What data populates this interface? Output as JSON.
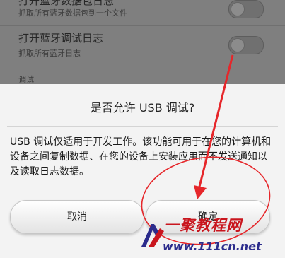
{
  "settings": {
    "row1": {
      "title": "打开蓝牙数据包日志",
      "subtitle": "抓取所有蓝牙数据包到一个文件"
    },
    "row2": {
      "title": "打开蓝牙调试日志",
      "subtitle": "抓取所有蓝牙日志"
    },
    "section_label": "调试"
  },
  "dialog": {
    "title": "是否允许 USB 调试?",
    "message": "USB 调试仅适用于开发工作。该功能可用于在您的计算机和设备之间复制数据、在您的设备上安装应用而不发送通知以及读取日志数据。",
    "cancel_label": "取消",
    "ok_label": "确定"
  },
  "annotation": {
    "arrow_color": "#e6262a",
    "circle_color": "#e6262a"
  },
  "watermark": {
    "brand": "一聚教程网",
    "url": "www.111cn.net"
  }
}
